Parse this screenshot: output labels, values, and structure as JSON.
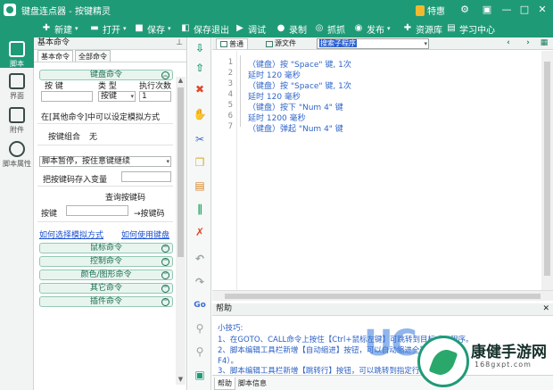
{
  "app": {
    "title": "键盘连点器 - 按键精灵",
    "vip_label": "特惠"
  },
  "toolbar": {
    "new": "新建",
    "open": "打开",
    "save": "保存",
    "save_exit": "保存退出",
    "debug": "调试",
    "record": "录制",
    "capture": "抓抓",
    "publish": "发布",
    "resources": "资源库",
    "learn": "学习中心"
  },
  "rail": {
    "script": "脚本",
    "ui": "界面",
    "attach": "附件",
    "props": "脚本属性"
  },
  "panel": {
    "title": "基本命令",
    "tabs": [
      "基本命令",
      "全部命令"
    ],
    "keyboard_group": "键盘命令",
    "col_key": "按 键",
    "col_type": "类 型",
    "col_count": "执行次数",
    "type_value": "按键",
    "count_value": "1",
    "mode_text": "在[其他命令]中可以设定模拟方式",
    "combo_label": "按键组合",
    "combo_value": "无",
    "pause_option": "脚本暂停，按住意键继续",
    "store_label": "把按键码存入变量",
    "query_title": "查询按键码",
    "key_label": "按键",
    "arrow_label": "→按键码",
    "link_mode": "如何选择模拟方式",
    "link_use": "如何使用键盘",
    "groups": [
      "鼠标命令",
      "控制命令",
      "颜色/图形命令",
      "其它命令",
      "插件命令"
    ]
  },
  "editor": {
    "tabs": [
      "普通",
      "源文件"
    ],
    "search_placeholder": "搜索子程序",
    "lines": [
      "1",
      "2",
      "3",
      "4",
      "5",
      "6",
      "7"
    ],
    "code": [
      "（键盘）按 \"Space\" 键, 1次",
      "延时 120 毫秒",
      "（键盘）按 \"Space\" 键, 1次",
      "延时 120 毫秒",
      "（键盘）按下 \"Num 4\" 键",
      "延时 1200 毫秒",
      "（键盘）弹起 \"Num 4\" 键"
    ]
  },
  "help": {
    "title": "帮助",
    "tips": [
      "小技巧:",
      "1、在GOTO、CALL命令上按住【Ctrl+鼠标左键】可跳转到目标或子程序。",
      "2、脚本编辑工具栏新增【自动缩进】按钮，可以自动缩进全部行（快捷键",
      "F4）。",
      "3、脚本编辑工具栏新增【跳转行】按钮，可以跳转到指定行号"
    ],
    "bottom_tabs": [
      "帮助",
      "脚本信息"
    ]
  },
  "watermark": {
    "uc": "UC",
    "brand": "康健手游网",
    "url": "168gxpt.com"
  },
  "colors": {
    "accent": "#1f9a77",
    "code": "#2f66c9",
    "link": "#1a4fd0"
  },
  "icons": [
    "new-icon",
    "open-icon",
    "save-icon",
    "debug-icon",
    "record-icon",
    "capture-icon",
    "publish-icon",
    "resource-icon",
    "learn-icon"
  ]
}
